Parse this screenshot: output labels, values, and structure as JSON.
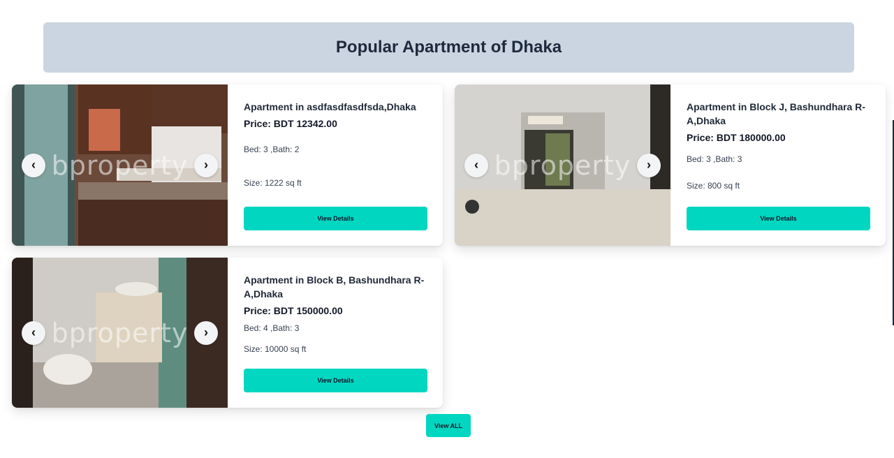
{
  "header": {
    "title": "Popular Apartment of Dhaka"
  },
  "watermark": "bproperty",
  "nav": {
    "prev": "‹",
    "next": "›"
  },
  "listings": [
    {
      "title": "Apartment in asdfasdfasdfsda,Dhaka",
      "price": "Price: BDT 12342.00",
      "beds": "Bed: 3 ,Bath: 2",
      "size": "Size: 1222 sq ft",
      "button": "View Details"
    },
    {
      "title": "Apartment in Block J, Bashundhara R-A,Dhaka",
      "price": "Price: BDT 180000.00",
      "beds": "Bed: 3 ,Bath: 3",
      "size": "Size: 800 sq ft",
      "button": "View Details"
    },
    {
      "title": "Apartment in Block B, Bashundhara R-A,Dhaka",
      "price": "Price: BDT 150000.00",
      "beds": "Bed: 4 ,Bath: 3",
      "size": "Size: 10000 sq ft",
      "button": "View Details"
    }
  ],
  "footer": {
    "view_all": "View ALL"
  },
  "colors": {
    "accent": "#00d6c0",
    "banner": "#cbd5e1"
  }
}
